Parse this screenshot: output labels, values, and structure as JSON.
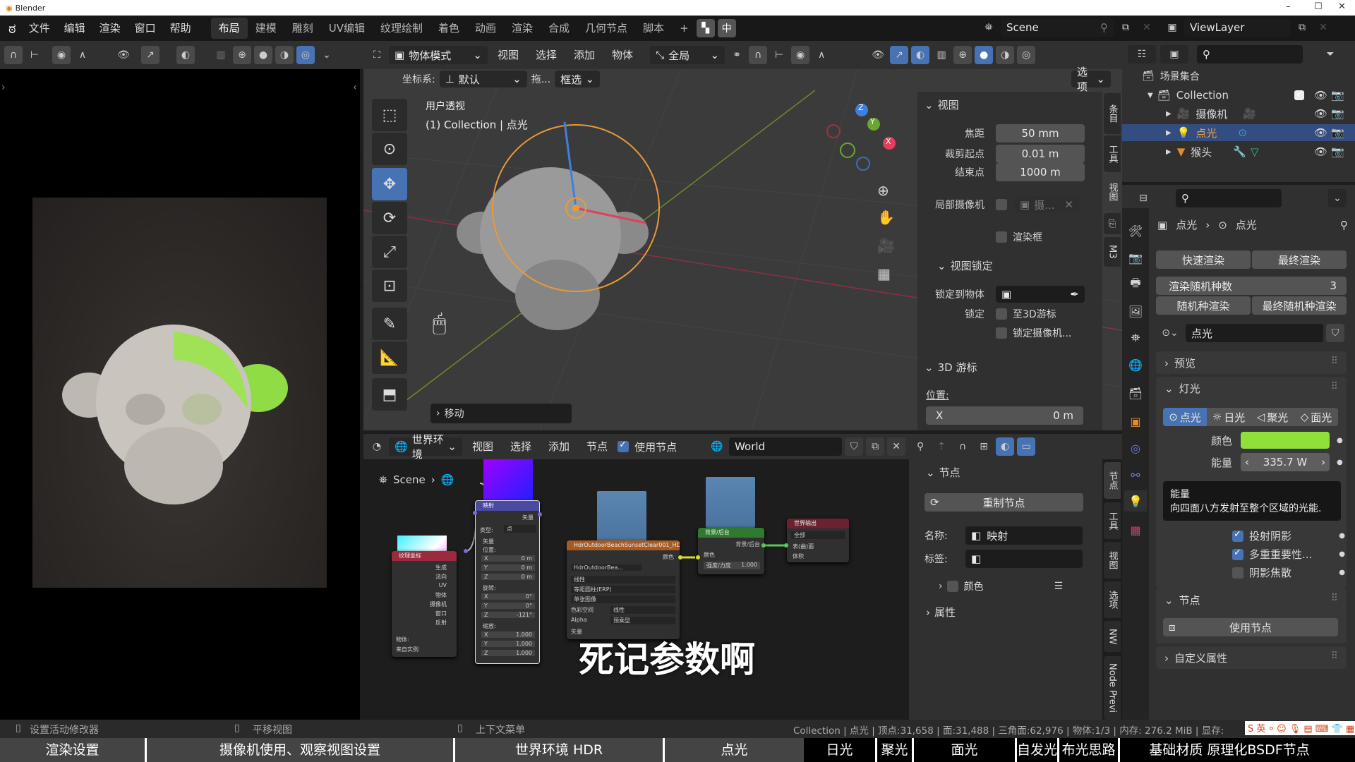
{
  "window": {
    "title": "Blender"
  },
  "menu": {
    "items": [
      "文件",
      "编辑",
      "渲染",
      "窗口",
      "帮助"
    ]
  },
  "workspaces": {
    "tabs": [
      "布局",
      "建模",
      "雕刻",
      "UV编辑",
      "纹理绘制",
      "着色",
      "动画",
      "渲染",
      "合成",
      "几何节点",
      "脚本"
    ],
    "active": "布局",
    "add_label": "+",
    "ime_label": "中"
  },
  "scene_selector": {
    "value": "Scene"
  },
  "viewlayer_selector": {
    "value": "ViewLayer"
  },
  "viewport": {
    "mode": "物体模式",
    "menus": [
      "视图",
      "选择",
      "添加",
      "物体"
    ],
    "transform_orientation": "全局",
    "coord_label": "坐标系:",
    "coord_value": "默认",
    "drag_label": "拖...",
    "select_mode": "框选",
    "options_label": "选项",
    "overlay_title": "用户透视",
    "overlay_subtitle": "(1) Collection | 点光",
    "last_op": "移动",
    "gizmo_axes": [
      "X",
      "Y",
      "Z"
    ]
  },
  "npanel": {
    "tabs": [
      "条目",
      "工具",
      "视图",
      "M3"
    ],
    "view_section": "视图",
    "focal_label": "焦距",
    "focal_value": "50 mm",
    "clip_start_label": "裁剪起点",
    "clip_start_value": "0.01 m",
    "clip_end_label": "结束点",
    "clip_end_value": "1000 m",
    "local_camera_label": "局部摄像机",
    "local_camera_value": "摄...",
    "render_region_label": "渲染框",
    "view_lock_section": "视图锁定",
    "lock_object_label": "锁定到物体",
    "lock_label": "锁定",
    "lock_3d_cursor": "至3D游标",
    "lock_camera": "锁定摄像机...",
    "cursor_section": "3D 游标",
    "location_label": "位置:",
    "x_label": "X",
    "x_value": "0 m"
  },
  "node_editor": {
    "editor_type": "世界环境",
    "menus": [
      "视图",
      "选择",
      "添加",
      "节点"
    ],
    "use_nodes_label": "使用节点",
    "use_nodes_checked": true,
    "world_name": "World",
    "breadcrumb": [
      "Scene"
    ],
    "nodes": {
      "texcoord": {
        "title": "纹理坐标",
        "outputs": [
          "生成",
          "法向",
          "UV",
          "物体",
          "摄像机",
          "窗口",
          "反射"
        ],
        "object_label": "物体:",
        "from_instancer": "来自实例"
      },
      "mapping": {
        "title": "映射",
        "output": "矢量",
        "type_label": "类型:",
        "type_value": "点",
        "vector": "矢量",
        "location": "位置:",
        "loc": [
          "0 m",
          "0 m",
          "0 m"
        ],
        "rotation": "旋转:",
        "rot": [
          "0°",
          "0°",
          "-121°"
        ],
        "scale": "缩放:",
        "scl": [
          "1.000",
          "1.000",
          "1.000"
        ],
        "axes": [
          "X",
          "Y",
          "Z"
        ]
      },
      "env": {
        "title": "HdrOutdoorBeachSunsetClear001_HD...",
        "output": "颜色",
        "image": "HdrOutdoorBea...",
        "interp": "线性",
        "projection": "等距圆柱(ERP)",
        "ext": "单张图像",
        "colorspace_label": "色彩空间",
        "colorspace": "线性",
        "alpha_label": "Alpha",
        "alpha": "预乘型",
        "input": "矢量"
      },
      "background": {
        "title": "背景/后台",
        "output": "背景/后台",
        "color": "颜色",
        "strength_label": "强度/力度",
        "strength": "1.000"
      },
      "output": {
        "title": "世界输出",
        "target": "全部",
        "surface": "表(曲)面",
        "volume": "体积"
      }
    },
    "side_tabs": [
      "节点",
      "工具",
      "视图",
      "选项",
      "NW",
      "Node Previ"
    ],
    "side": {
      "section": "节点",
      "reset_label": "重制节点",
      "name_label": "名称:",
      "name_value": "映射",
      "label_label": "标签:",
      "label_value": "",
      "color_label": "颜色",
      "properties_section": "属性"
    }
  },
  "outliner": {
    "root": "场景集合",
    "items": [
      {
        "name": "Collection",
        "level": 0
      },
      {
        "name": "摄像机",
        "level": 1
      },
      {
        "name": "点光",
        "level": 1,
        "selected": true
      },
      {
        "name": "猴头",
        "level": 1
      }
    ]
  },
  "properties": {
    "breadcrumb": [
      "点光",
      "点光"
    ],
    "quick_render": "快速渲染",
    "final_render": "最终渲染",
    "seed_label": "渲染随机种数",
    "seed_value": "3",
    "random_render": "随机种渲染",
    "final_random_render": "最终随机种渲染",
    "light_data_name": "点光",
    "preview_section": "预览",
    "light_section": "灯光",
    "light_types": [
      "点光",
      "日光",
      "聚光",
      "面光"
    ],
    "active_light_type": "点光",
    "color_label": "颜色",
    "light_color": "#8fe13a",
    "power_label": "能量",
    "power_value": "335.7 W",
    "tooltip_title": "能量",
    "tooltip_body": "向四面八方发射至整个区域的光能.",
    "cast_shadow": "投射阴影",
    "multiple_importance": "多重重要性...",
    "shadow_caustics": "阴影焦散",
    "nodes_section": "节点",
    "use_nodes": "使用节点",
    "custom_props": "自定义属性"
  },
  "statusbar": {
    "hint_left": "设置活动修改器",
    "hint_mid": "平移视图",
    "hint_right": "上下文菜单",
    "stats": "Collection | 点光 | 顶点:31,658 | 面:31,488 | 三角面:62,976 | 物体:1/3 | 内存: 276.2 MiB | 显存:"
  },
  "subtitle_bar": [
    "渲染设置",
    "摄像机使用、观察视图设置",
    "世界环境 HDR",
    "点光",
    "日光",
    "聚光",
    "面光",
    "自发光",
    "布光思路",
    "基础材质 原理化BSDF节点"
  ],
  "caption": "死记参数啊"
}
